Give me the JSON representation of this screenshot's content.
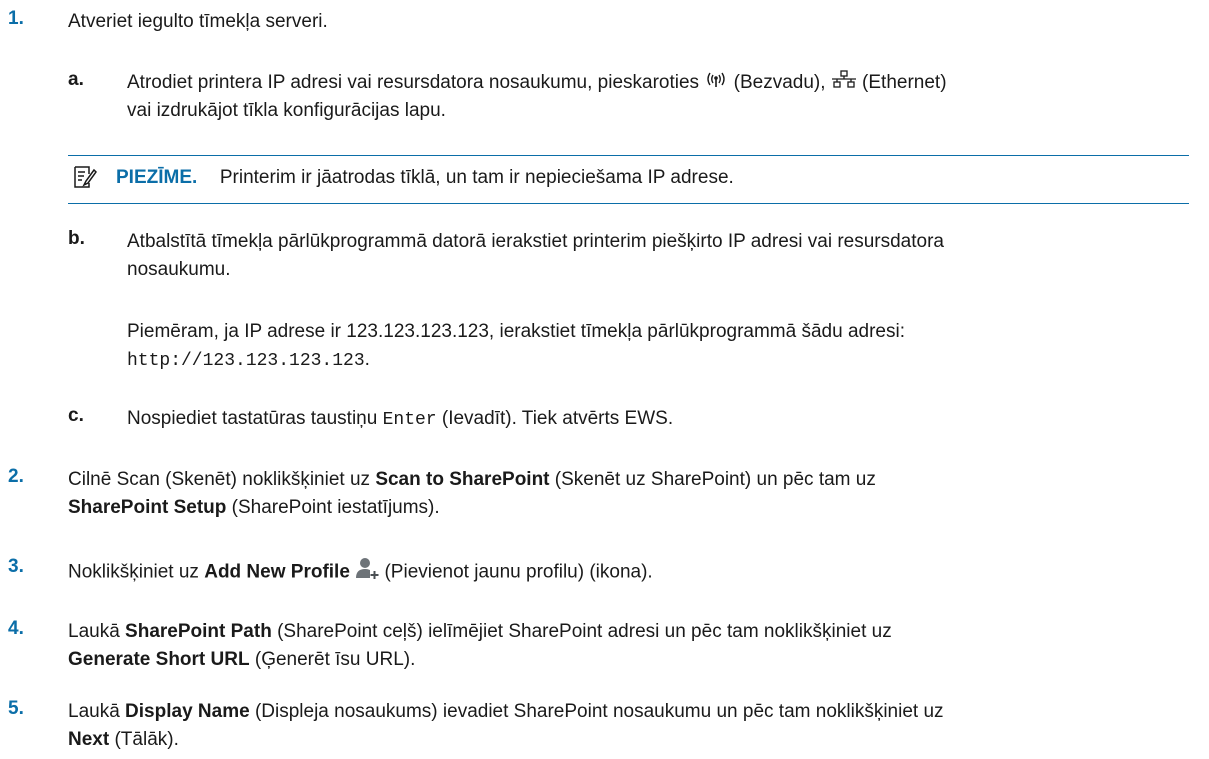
{
  "steps": [
    {
      "num": "1.",
      "text": "Atveriet iegulto tīmekļa serveri."
    },
    {
      "num": "2.",
      "pre": "Cilnē Scan (Skenēt) noklikšķiniet uz ",
      "b1": "Scan to SharePoint",
      "mid": " (Skenēt uz SharePoint) un pēc tam uz",
      "b2": "SharePoint Setup",
      "post": " (SharePoint iestatījums)."
    },
    {
      "num": "3.",
      "pre": "Noklikšķiniet uz ",
      "b1": "Add New Profile",
      "post": " (Pievienot jaunu profilu) (ikona)."
    },
    {
      "num": "4.",
      "pre": "Laukā ",
      "b1": "SharePoint Path",
      "mid": " (SharePoint ceļš) ielīmējiet SharePoint adresi un pēc tam noklikšķiniet uz",
      "b2": "Generate Short URL",
      "post": " (Ģenerēt īsu URL)."
    },
    {
      "num": "5.",
      "pre": "Laukā ",
      "b1": "Display Name",
      "mid": " (Displeja nosaukums) ievadiet SharePoint nosaukumu un pēc tam noklikšķiniet uz",
      "b2": "Next",
      "post": " (Tālāk)."
    }
  ],
  "substeps": {
    "a": {
      "letter": "a.",
      "pre": "Atrodiet printera IP adresi vai resursdatora nosaukumu, pieskaroties ",
      "wireless": " (Bezvadu), ",
      "ethernet": " (Ethernet)",
      "line2": "vai izdrukājot tīkla konfigurācijas lapu."
    },
    "b": {
      "letter": "b.",
      "line1": "Atbalstītā tīmekļa pārlūkprogrammā datorā ierakstiet printerim piešķirto IP adresi vai resursdatora",
      "line2": "nosaukumu.",
      "ex1": "Piemēram, ja IP adrese ir 123.123.123.123, ierakstiet tīmekļa pārlūkprogrammā šādu adresi:",
      "ex_url": "http://123.123.123.123",
      "ex_end": "."
    },
    "c": {
      "letter": "c.",
      "pre": "Nospiediet tastatūras taustiņu ",
      "key": "Enter",
      "post": " (Ievadīt). Tiek atvērts EWS."
    }
  },
  "note": {
    "label": "PIEZĪME.",
    "text": "Printerim ir jāatrodas tīklā, un tam ir nepieciešama IP adrese."
  },
  "icons": {
    "note": "note-pencil-icon",
    "wireless": "wireless-icon",
    "ethernet": "ethernet-icon",
    "add_profile": "add-profile-icon"
  },
  "colors": {
    "accent": "#0b6ea8",
    "text": "#1a1a1a"
  }
}
